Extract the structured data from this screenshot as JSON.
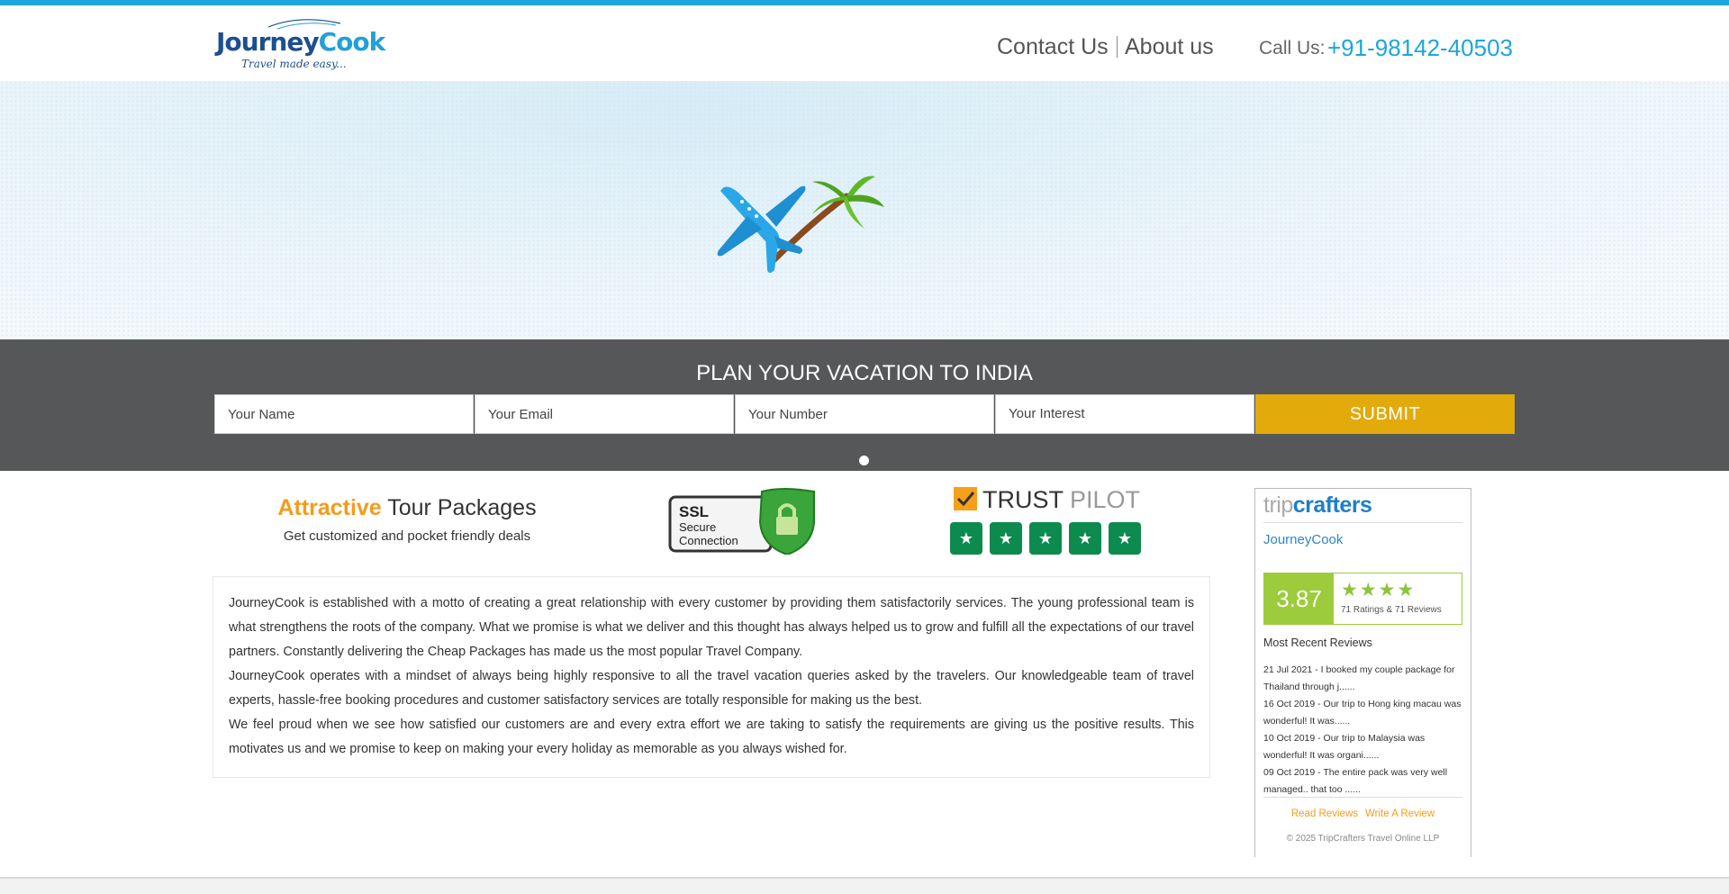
{
  "colors": {
    "accent_blue": "#1ea5dc",
    "submit": "#e3aa0c",
    "orange": "#f39c1b",
    "trust_green": "#0d8a4e",
    "tc_green": "#9ccc3c"
  },
  "brand": {
    "logo_part1": "Journey",
    "logo_part2": "Cook",
    "tagline": "Travel made easy..."
  },
  "nav": {
    "contact": "Contact Us",
    "about": "About us",
    "call_label": "Call Us:",
    "phone": "+91-98142-40503"
  },
  "hero": {
    "image": "airplane-with-palm-tree"
  },
  "plan": {
    "title": "PLAN YOUR VACATION TO INDIA",
    "name_placeholder": "Your Name",
    "email_placeholder": "Your Email",
    "number_placeholder": "Your Number",
    "interest_value": "Your Interest",
    "submit": "SUBMIT"
  },
  "packages": {
    "highlight": "Attractive",
    "rest": " Tour Packages",
    "subtitle": "Get customized and pocket friendly deals"
  },
  "ssl": {
    "line1": "SSL",
    "line2": "Secure",
    "line3": "Connection"
  },
  "trust": {
    "word1": "TRUST",
    "word2": "PILOT",
    "stars": 5
  },
  "about": {
    "paragraphs": [
      "JourneyCook is established with a motto of creating a great relationship with every customer by providing them satisfactorily services. The young professional team is what strengthens the roots of the company. What we promise is what we deliver and this thought has always helped us to grow and fulfill all the expectations of our travel partners. Constantly delivering the Cheap Packages has made us the most popular Travel Company.",
      "JourneyCook operates with a mindset of always being highly responsive to all the travel vacation queries asked by the travelers. Our knowledgeable team of travel experts, hassle-free booking procedures and customer satisfactory services are totally responsible for making us the best.",
      "We feel proud when we see how satisfied our customers are and every extra effort we are taking to satisfy the requirements are giving us the positive results. This motivates us and we promise to keep on making your every holiday as memorable as you always wished for."
    ]
  },
  "tripcrafters": {
    "logo_a": "trip",
    "logo_b": "crafters",
    "company": "JourneyCook",
    "score": "3.87",
    "stars": "★★★★",
    "count": "71 Ratings & 71 Reviews",
    "recent_title": "Most Recent Reviews",
    "reviews": [
      "21 Jul 2021 - I booked my couple package for Thailand through j......",
      "16 Oct 2019 - Our trip to Hong king macau was wonderful! It was......",
      "10 Oct 2019 - Our trip to Malaysia was wonderful! It was organi......",
      "09 Oct 2019 - The entire pack was very well managed.. that too ......"
    ],
    "read": "Read Reviews",
    "write": "Write A Review",
    "copyright": "© 2025 TripCrafters Travel Online LLP"
  }
}
